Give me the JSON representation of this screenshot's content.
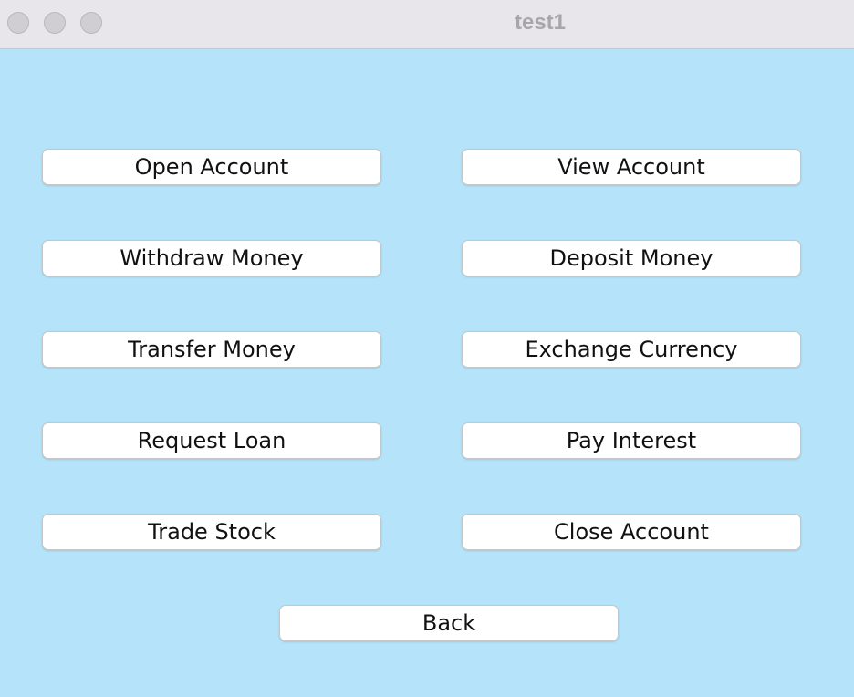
{
  "window": {
    "title": "test1"
  },
  "buttons": {
    "open_account": "Open Account",
    "view_account": "View Account",
    "withdraw_money": "Withdraw Money",
    "deposit_money": "Deposit Money",
    "transfer_money": "Transfer Money",
    "exchange_currency": "Exchange Currency",
    "request_loan": "Request Loan",
    "pay_interest": "Pay Interest",
    "trade_stock": "Trade Stock",
    "close_account": "Close Account",
    "back": "Back"
  },
  "colors": {
    "background": "#b5e3f9",
    "titlebar": "#e8e6eb",
    "title_text": "#a8a6ab",
    "button_face": "#ffffff"
  }
}
